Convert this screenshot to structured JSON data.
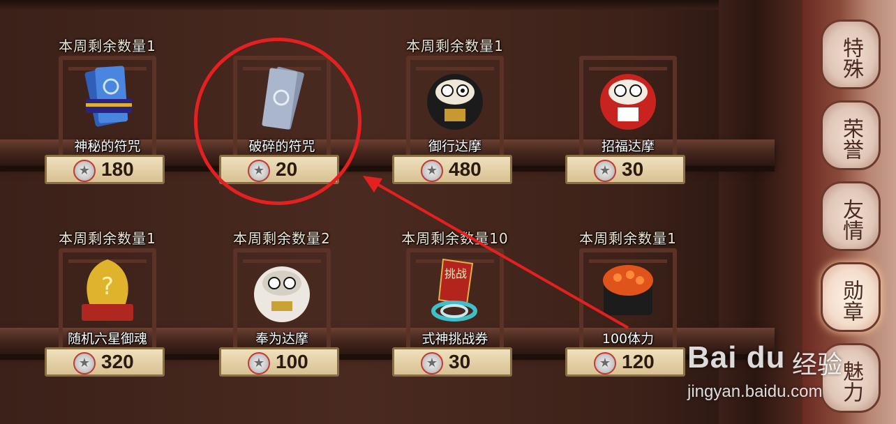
{
  "shop": {
    "items": [
      {
        "limit": "本周剩余数量1",
        "name": "神秘的符咒",
        "price": "180",
        "icon": "blue-charm-icon"
      },
      {
        "limit": "",
        "name": "破碎的符咒",
        "price": "20",
        "icon": "broken-charm-icon"
      },
      {
        "limit": "本周剩余数量1",
        "name": "御行达摩",
        "price": "480",
        "icon": "black-daruma-icon"
      },
      {
        "limit": "",
        "name": "招福达摩",
        "price": "30",
        "icon": "red-daruma-icon"
      },
      {
        "limit": "本周剩余数量1",
        "name": "随机六星御魂",
        "price": "320",
        "icon": "golden-soul-icon"
      },
      {
        "limit": "本周剩余数量2",
        "name": "奉为达摩",
        "price": "100",
        "icon": "white-daruma-icon"
      },
      {
        "limit": "本周剩余数量10",
        "name": "式神挑战券",
        "price": "30",
        "icon": "challenge-ticket-icon"
      },
      {
        "limit": "本周剩余数量1",
        "name": "100体力",
        "price": "120",
        "icon": "stamina-sushi-icon"
      }
    ],
    "currency_icon": "medal-coin-icon"
  },
  "tabs": [
    {
      "label": "特殊",
      "active": false
    },
    {
      "label": "荣誉",
      "active": false
    },
    {
      "label": "友情",
      "active": false
    },
    {
      "label": "勋章",
      "active": true
    },
    {
      "label": "魅力",
      "active": false
    }
  ],
  "ticket_text": "挑战",
  "coin_glyph": "★",
  "annotation": {
    "color": "#e62020"
  },
  "watermark": {
    "logo": "Bai du",
    "cn": "经验",
    "url": "jingyan.baidu.com"
  }
}
